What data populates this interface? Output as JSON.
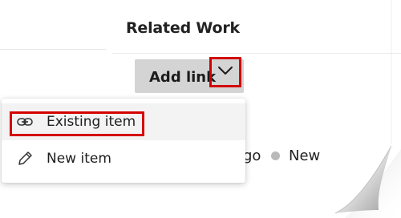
{
  "panel": {
    "title": "Related Work"
  },
  "add_link": {
    "label": "Add link",
    "chevron_icon": "chevron-down-icon"
  },
  "status": {
    "prefix_text": "go",
    "new_label": "New"
  },
  "menu": {
    "items": [
      {
        "label": "Existing item",
        "icon": "link-icon",
        "hovered": true,
        "highlighted": true
      },
      {
        "label": "New item",
        "icon": "pencil-icon",
        "hovered": false,
        "highlighted": false
      }
    ]
  },
  "colors": {
    "highlight": "#d40000",
    "button_bg": "#d4d4d4",
    "hover_bg": "#f3f3f3",
    "dot": "#b9b9b9"
  }
}
